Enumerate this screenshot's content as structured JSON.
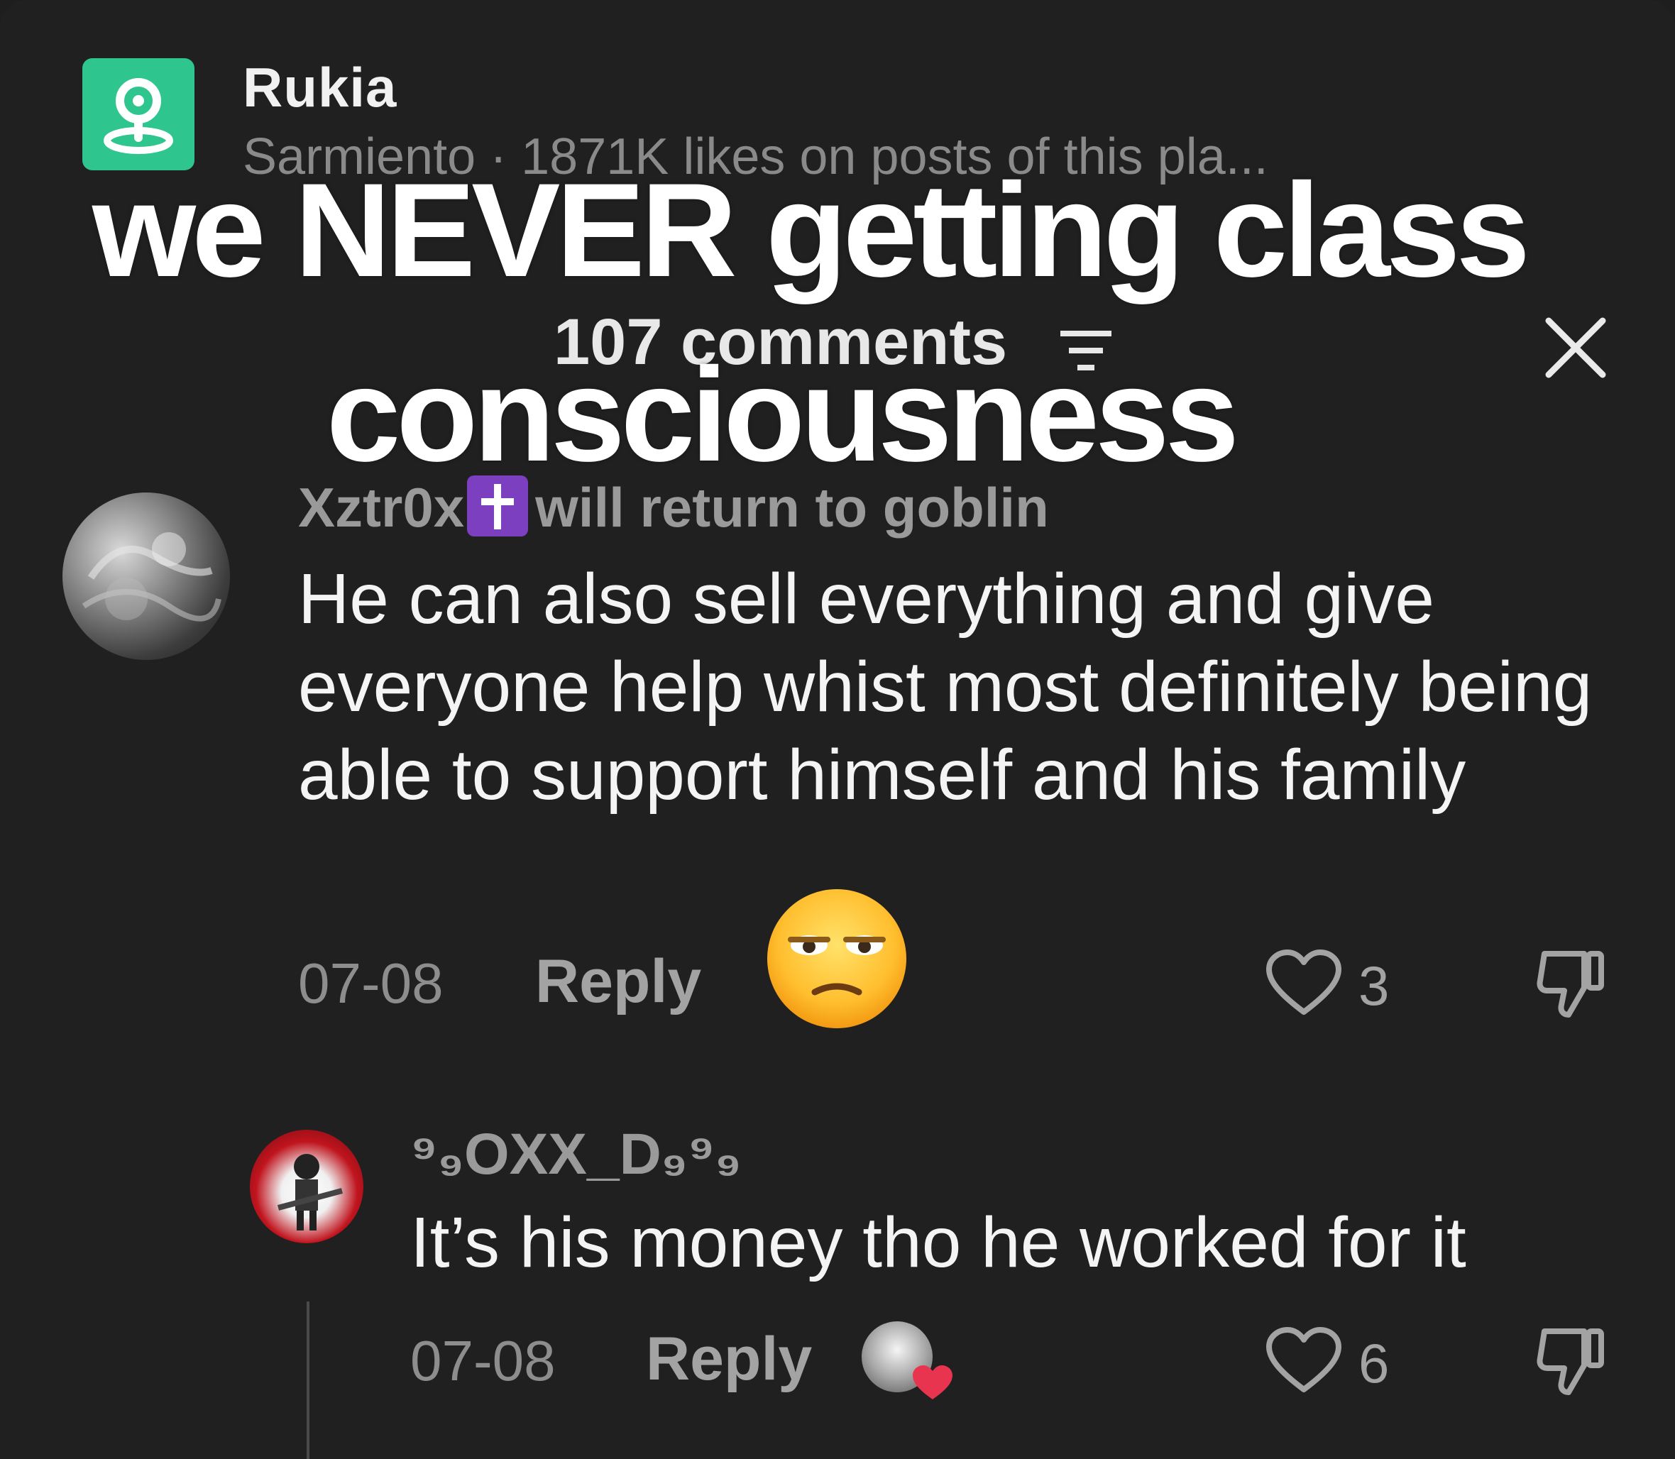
{
  "place": {
    "title": "Rukia",
    "subtitle": "Sarmiento · 1871K likes on posts of this pla...",
    "icon": "location-pin-icon",
    "accent": "#2ec58e"
  },
  "overlay": {
    "line1": "we NEVER getting class",
    "line2": "consciousness"
  },
  "header": {
    "comments_label": "107 comments",
    "filter_icon": "sort-filter-icon",
    "close_icon": "close-icon"
  },
  "comments": [
    {
      "username": "Xztr0x",
      "username_suffix": "will return to goblin",
      "badge_icon": "latin-cross-icon",
      "text": "He can also sell everything and give everyone help whist most definitely being able to support himself and his family",
      "date": "07-08",
      "reply_label": "Reply",
      "reaction_emoji": "😒",
      "likes": "3",
      "avatar_icon": "avatar-icon",
      "like_icon": "heart-icon",
      "dislike_icon": "thumbs-down-icon"
    },
    {
      "username": "⁹₉OXX_D₉⁹₉",
      "text": "It’s his money tho he worked for it",
      "date": "07-08",
      "reply_label": "Reply",
      "likes": "6",
      "avatar_icon": "avatar-icon",
      "like_icon": "heart-icon",
      "dislike_icon": "thumbs-down-icon",
      "creator_liked_icon": "creator-liked-heart-icon"
    }
  ],
  "colors": {
    "background": "#202020",
    "muted_text": "#8d8d8d",
    "text": "#f4f4f4",
    "badge": "#7b3fbf",
    "heart": "#e8344e"
  }
}
